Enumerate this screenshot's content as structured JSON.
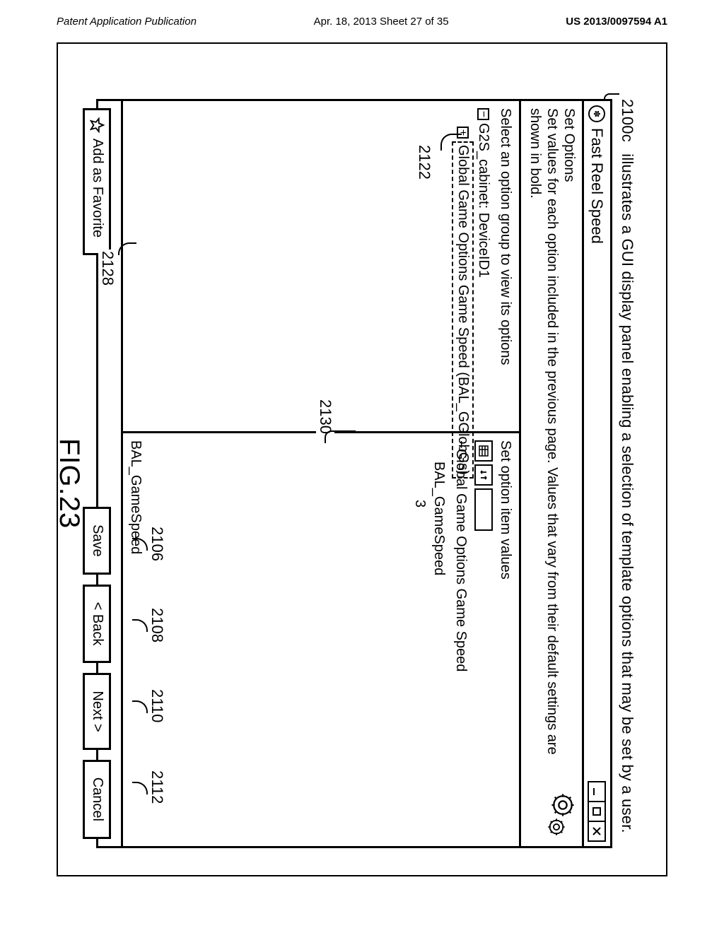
{
  "page_header": {
    "left": "Patent Application Publication",
    "center": "Apr. 18, 2013  Sheet 27 of 35",
    "right": "US 2013/0097594 A1"
  },
  "caption": {
    "ref": "2100c",
    "text": "illustrates a GUI display panel enabling a selection of template options that may be set by a user."
  },
  "window": {
    "title": "Fast Reel Speed",
    "banner_title": "Set Options",
    "banner_desc": "Set values for each option included in the previous page. Values that vary from their default settings are shown in bold.",
    "left_heading": "Select an option group to view its options",
    "right_heading": "Set option item values",
    "left_tree": {
      "root": "G2S_cabinet: DeviceID1",
      "child_selected": "Global Game Options Game Speed (BAL_GGlobGs)"
    },
    "right_tree": {
      "root": "Global Game Options Game Speed",
      "name": "BAL_GameSpeed",
      "value": "3"
    },
    "field_label": "BAL_GameSpeed",
    "buttons": {
      "favorite": "Add as Favorite",
      "save": "Save",
      "back": "< Back",
      "next": "Next >",
      "cancel": "Cancel"
    }
  },
  "callouts": {
    "c2122": "2122",
    "c2128": "2128",
    "c2130": "2130",
    "c2106": "2106",
    "c2108": "2108",
    "c2110": "2110",
    "c2112": "2112"
  },
  "figure_label": "FIG.23"
}
